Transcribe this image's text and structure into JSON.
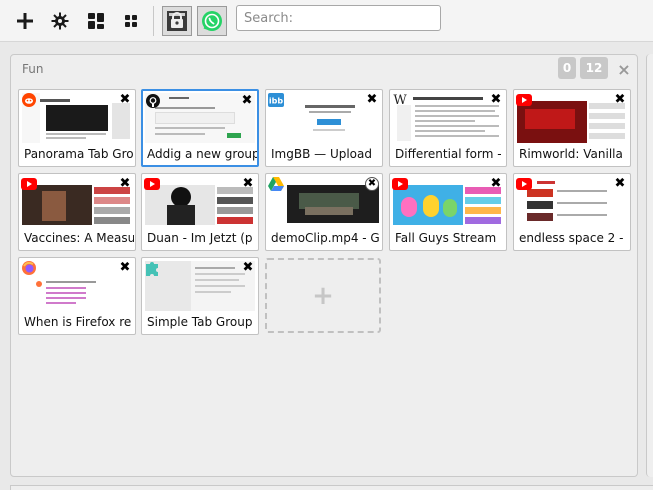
{
  "toolbar": {
    "buttons": [
      {
        "name": "add-group-button",
        "icon": "plus-icon"
      },
      {
        "name": "settings-button",
        "icon": "gear-icon"
      },
      {
        "name": "layout-button",
        "icon": "grid-large-icon"
      },
      {
        "name": "arrange-button",
        "icon": "grid-small-icon"
      }
    ],
    "apps": [
      {
        "name": "lock-app-icon",
        "icon": "lock-icon"
      },
      {
        "name": "whatsapp-app-icon",
        "icon": "whatsapp-icon"
      }
    ],
    "search": {
      "value": "",
      "placeholder": "Search:"
    }
  },
  "group": {
    "title": "Fun",
    "badge_left": "0",
    "badge_right": "12",
    "close": "×",
    "new_tab": "+"
  },
  "tabs": [
    {
      "title": "Panorama Tab Group",
      "favicon": "reddit-icon",
      "color": "#ff4500"
    },
    {
      "title": "Addig a new group",
      "favicon": "github-icon",
      "color": "#111111",
      "active": true
    },
    {
      "title": "ImgBB — Upload",
      "favicon": "imgbb-icon",
      "color": "#2d8fd6"
    },
    {
      "title": "Differential form -",
      "favicon": "wikipedia-icon",
      "color": "#333333"
    },
    {
      "title": "Rimworld: Vanilla",
      "favicon": "youtube-icon",
      "color": "#ff0000"
    },
    {
      "title": "Vaccines: A Measured",
      "favicon": "youtube-icon",
      "color": "#ff0000"
    },
    {
      "title": "Duan - Im Jetzt (p",
      "favicon": "youtube-icon",
      "color": "#ff0000"
    },
    {
      "title": "demoClip.mp4 - G",
      "favicon": "google-drive-icon",
      "color": "#1fa463"
    },
    {
      "title": "Fall Guys Stream",
      "favicon": "youtube-icon",
      "color": "#ff0000"
    },
    {
      "title": "endless space 2 -",
      "favicon": "youtube-icon",
      "color": "#ff0000"
    },
    {
      "title": "When is Firefox re",
      "favicon": "firefox-icon",
      "color": "#ff7139"
    },
    {
      "title": "Simple Tab Group",
      "favicon": "puzzle-icon",
      "color": "#45c2b6"
    }
  ]
}
